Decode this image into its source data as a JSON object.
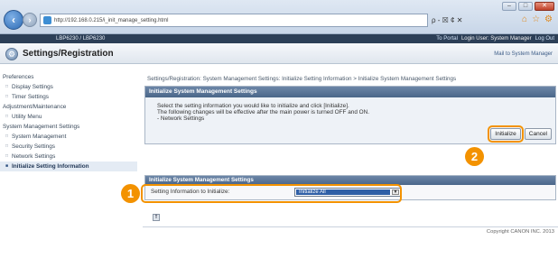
{
  "browser": {
    "url": "http://192.168.0.215/i_init_manage_setting.html",
    "window_controls": [
      "–",
      "□",
      "✕"
    ],
    "address_controls": "ρ - ☒ ¢ ✕",
    "toolbar_icons": [
      "⌂",
      "☆",
      "⚙"
    ]
  },
  "topbar": {
    "product": "LBP6230 / LBP6230",
    "links": [
      "To Portal",
      "Login User: System Manager",
      "Log Out"
    ]
  },
  "header": {
    "title": "Settings/Registration",
    "mail_link": "Mail to System Manager"
  },
  "sidebar": {
    "sections": [
      {
        "heading": "Preferences",
        "items": [
          "Display Settings",
          "Timer Settings"
        ]
      },
      {
        "heading": "Adjustment/Maintenance",
        "items": [
          "Utility Menu"
        ]
      },
      {
        "heading": "System Management Settings",
        "items": [
          "System Management",
          "Security Settings",
          "Network Settings",
          "Initialize Setting Information"
        ]
      }
    ],
    "active_item": "Initialize Setting Information"
  },
  "breadcrumb": "Settings/Registration: System Management Settings: Initialize Setting Information > Initialize System Management Settings",
  "panel1": {
    "title": "Initialize System Management Settings",
    "line1": "Select the setting information you would like to initialize and click [Initialize].",
    "line2": "The following changes will be effective after the main power is turned OFF and ON.",
    "line3": "- Network Settings",
    "initialize_label": "Initialize",
    "cancel_label": "Cancel"
  },
  "panel2": {
    "title": "Initialize System Management Settings",
    "row_label": "Setting Information to Initialize:",
    "select_value": "Initialize All"
  },
  "callouts": {
    "one": "1",
    "two": "2"
  },
  "footer": {
    "top_icon": "⇑",
    "copyright": "Copyright CANON INC. 2013"
  },
  "colors": {
    "accent": "#f39200",
    "header": "#4a6689",
    "topbar": "#2c3f57"
  }
}
